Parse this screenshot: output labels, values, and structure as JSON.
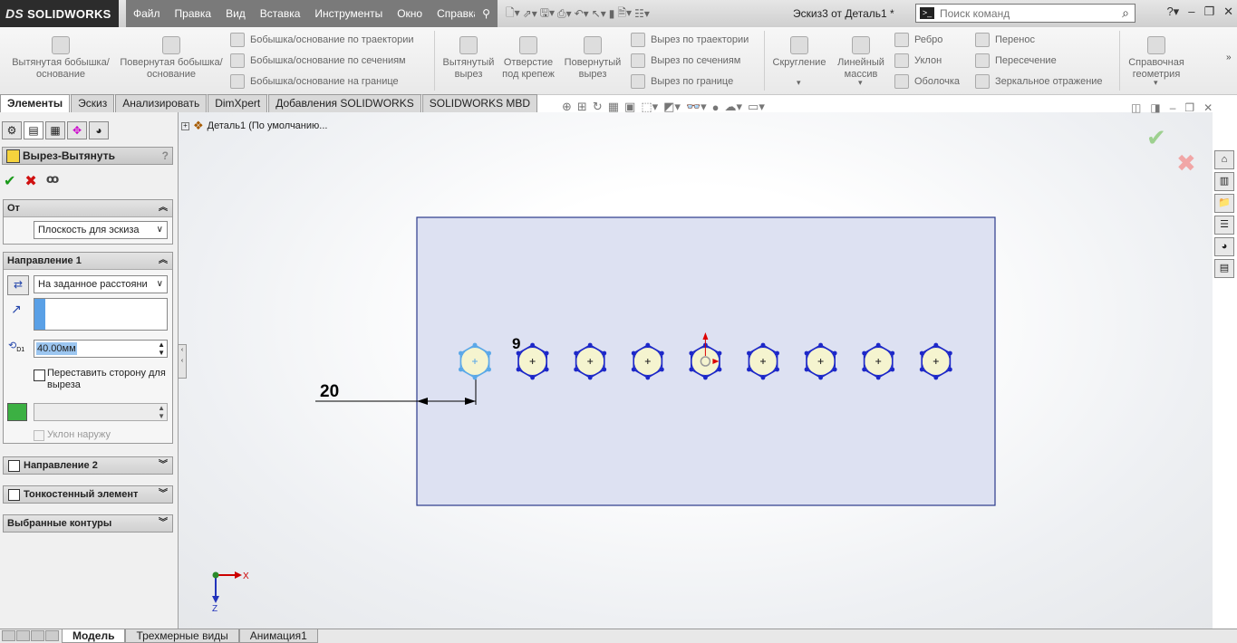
{
  "app": {
    "logo": "SOLIDWORKS",
    "document_title": "Эскиз3 от Деталь1 *"
  },
  "menu": [
    "Файл",
    "Правка",
    "Вид",
    "Вставка",
    "Инструменты",
    "Окно",
    "Справка"
  ],
  "search": {
    "placeholder": "Поиск команд"
  },
  "ribbon": {
    "extruded_boss": "Вытянутая бобышка/основание",
    "revolved_boss": "Повернутая бобышка/основание",
    "swept_boss": "Бобышка/основание по траектории",
    "lofted_boss": "Бобышка/основание по сечениям",
    "boundary_boss": "Бобышка/основание на границе",
    "extruded_cut": "Вытянутый вырез",
    "hole_wizard": "Отверстие под крепеж",
    "revolved_cut": "Повернутый вырез",
    "swept_cut": "Вырез по траектории",
    "lofted_cut": "Вырез по сечениям",
    "boundary_cut": "Вырез по границе",
    "fillet": "Скругление",
    "linear_pattern": "Линейный массив",
    "rib": "Ребро",
    "draft": "Уклон",
    "shell": "Оболочка",
    "wrap": "Перенос",
    "intersect": "Пересечение",
    "mirror": "Зеркальное отражение",
    "ref_geometry": "Справочная геометрия"
  },
  "tabs": [
    "Элементы",
    "Эскиз",
    "Анализировать",
    "DimXpert",
    "Добавления SOLIDWORKS",
    "SOLIDWORKS MBD"
  ],
  "tree": {
    "root": "Деталь1  (По умолчанию..."
  },
  "property_manager": {
    "title": "Вырез-Вытянуть",
    "from": {
      "heading": "От",
      "value": "Плоскость для эскиза"
    },
    "direction1": {
      "heading": "Направление 1",
      "end_condition": "На заданное расстояни",
      "depth": "40.00мм",
      "flip_side": "Переставить сторону для выреза",
      "draft_outward": "Уклон наружу"
    },
    "direction2": "Направление 2",
    "thin_feature": "Тонкостенный элемент",
    "selected_contours": "Выбранные контуры"
  },
  "sketch": {
    "dim_offset": "20",
    "dim_count": "9"
  },
  "triad": {
    "x": "X",
    "z": "Z"
  },
  "bottom_tabs": [
    "Модель",
    "Трехмерные виды",
    "Анимация1"
  ],
  "colors": {
    "plate_fill": "#dde1f2",
    "plate_stroke": "#2b3a8c",
    "hex_stroke": "#1d28c8",
    "hole_fill": "#f5f4cf",
    "accent": "#7a7a7a"
  }
}
